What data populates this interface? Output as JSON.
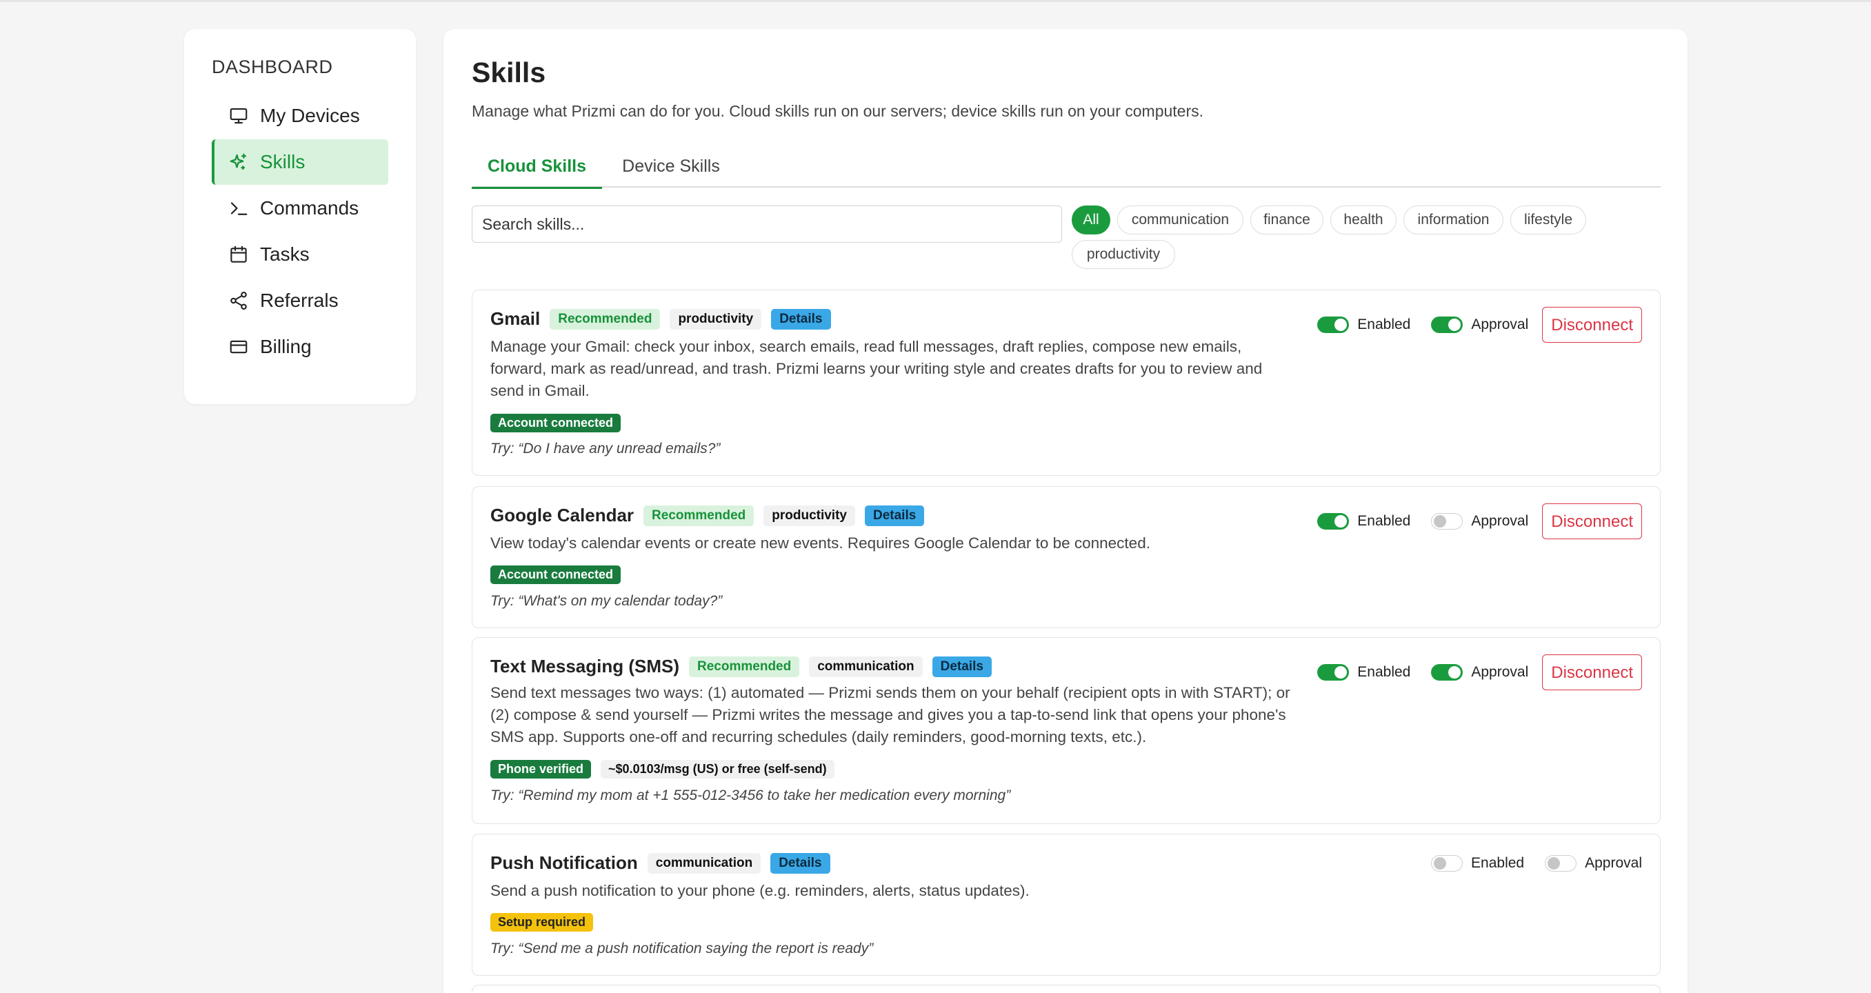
{
  "sidebar": {
    "title": "DASHBOARD",
    "items": [
      {
        "label": "My Devices",
        "icon": "monitor-icon"
      },
      {
        "label": "Skills",
        "icon": "sparkle-icon"
      },
      {
        "label": "Commands",
        "icon": "terminal-icon"
      },
      {
        "label": "Tasks",
        "icon": "calendar-icon"
      },
      {
        "label": "Referrals",
        "icon": "share-icon"
      },
      {
        "label": "Billing",
        "icon": "credit-card-icon"
      }
    ],
    "active_index": 1
  },
  "main": {
    "title": "Skills",
    "subtitle": "Manage what Prizmi can do for you. Cloud skills run on our servers; device skills run on your computers.",
    "tabs": [
      {
        "label": "Cloud Skills",
        "active": true
      },
      {
        "label": "Device Skills",
        "active": false
      }
    ],
    "search": {
      "placeholder": "Search skills...",
      "value": ""
    },
    "filters": [
      "All",
      "communication",
      "finance",
      "health",
      "information",
      "lifestyle",
      "productivity"
    ],
    "active_filter": "All"
  },
  "controls": {
    "enabled_label": "Enabled",
    "approval_label": "Approval",
    "disconnect_label": "Disconnect",
    "details_label": "Details"
  },
  "skills": [
    {
      "name": "Gmail",
      "recommended": "Recommended",
      "category": "productivity",
      "description": "Manage your Gmail: check your inbox, search emails, read full messages, draft replies, compose new emails, forward, mark as read/unread, and trash. Prizmi learns your writing style and creates drafts for you to review and send in Gmail.",
      "status": "Account connected",
      "try": "Try: “Do I have any unread emails?”",
      "enabled": true,
      "approval": true
    },
    {
      "name": "Google Calendar",
      "recommended": "Recommended",
      "category": "productivity",
      "description": "View today's calendar events or create new events. Requires Google Calendar to be connected.",
      "status": "Account connected",
      "try": "Try: “What's on my calendar today?”",
      "enabled": true,
      "approval": false
    },
    {
      "name": "Text Messaging (SMS)",
      "recommended": "Recommended",
      "category": "communication",
      "description": "Send text messages two ways: (1) automated — Prizmi sends them on your behalf (recipient opts in with START); or (2) compose & send yourself — Prizmi writes the message and gives you a tap-to-send link that opens your phone's SMS app. Supports one-off and recurring schedules (daily reminders, good-morning texts, etc.).",
      "status": "Phone verified",
      "price": "~$0.0103/msg (US) or free (self-send)",
      "try": "Try: “Remind my mom at +1 555-012-3456 to take her medication every morning”",
      "enabled": true,
      "approval": true
    },
    {
      "name": "Push Notification",
      "category": "communication",
      "description": "Send a push notification to your phone (e.g. reminders, alerts, status updates).",
      "status": "Setup required",
      "try": "Try: “Send me a push notification saying the report is ready”",
      "enabled": false,
      "approval": false
    }
  ],
  "colors": {
    "accent": "#1a9c3e",
    "accent_bg": "#d9f2dd",
    "details": "#3aa8e6",
    "danger": "#dc3545",
    "warning": "#f4c20d"
  }
}
